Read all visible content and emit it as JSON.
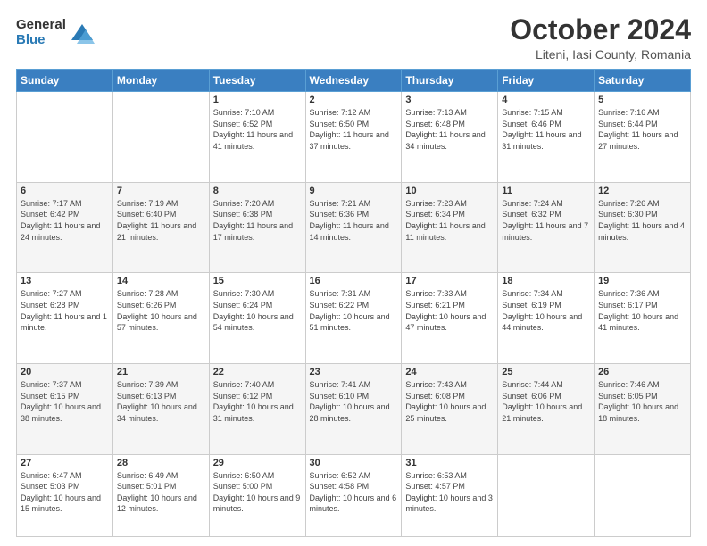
{
  "header": {
    "logo_general": "General",
    "logo_blue": "Blue",
    "month": "October 2024",
    "location": "Liteni, Iasi County, Romania"
  },
  "days_of_week": [
    "Sunday",
    "Monday",
    "Tuesday",
    "Wednesday",
    "Thursday",
    "Friday",
    "Saturday"
  ],
  "weeks": [
    [
      {
        "day": "",
        "detail": ""
      },
      {
        "day": "",
        "detail": ""
      },
      {
        "day": "1",
        "detail": "Sunrise: 7:10 AM\nSunset: 6:52 PM\nDaylight: 11 hours and 41 minutes."
      },
      {
        "day": "2",
        "detail": "Sunrise: 7:12 AM\nSunset: 6:50 PM\nDaylight: 11 hours and 37 minutes."
      },
      {
        "day": "3",
        "detail": "Sunrise: 7:13 AM\nSunset: 6:48 PM\nDaylight: 11 hours and 34 minutes."
      },
      {
        "day": "4",
        "detail": "Sunrise: 7:15 AM\nSunset: 6:46 PM\nDaylight: 11 hours and 31 minutes."
      },
      {
        "day": "5",
        "detail": "Sunrise: 7:16 AM\nSunset: 6:44 PM\nDaylight: 11 hours and 27 minutes."
      }
    ],
    [
      {
        "day": "6",
        "detail": "Sunrise: 7:17 AM\nSunset: 6:42 PM\nDaylight: 11 hours and 24 minutes."
      },
      {
        "day": "7",
        "detail": "Sunrise: 7:19 AM\nSunset: 6:40 PM\nDaylight: 11 hours and 21 minutes."
      },
      {
        "day": "8",
        "detail": "Sunrise: 7:20 AM\nSunset: 6:38 PM\nDaylight: 11 hours and 17 minutes."
      },
      {
        "day": "9",
        "detail": "Sunrise: 7:21 AM\nSunset: 6:36 PM\nDaylight: 11 hours and 14 minutes."
      },
      {
        "day": "10",
        "detail": "Sunrise: 7:23 AM\nSunset: 6:34 PM\nDaylight: 11 hours and 11 minutes."
      },
      {
        "day": "11",
        "detail": "Sunrise: 7:24 AM\nSunset: 6:32 PM\nDaylight: 11 hours and 7 minutes."
      },
      {
        "day": "12",
        "detail": "Sunrise: 7:26 AM\nSunset: 6:30 PM\nDaylight: 11 hours and 4 minutes."
      }
    ],
    [
      {
        "day": "13",
        "detail": "Sunrise: 7:27 AM\nSunset: 6:28 PM\nDaylight: 11 hours and 1 minute."
      },
      {
        "day": "14",
        "detail": "Sunrise: 7:28 AM\nSunset: 6:26 PM\nDaylight: 10 hours and 57 minutes."
      },
      {
        "day": "15",
        "detail": "Sunrise: 7:30 AM\nSunset: 6:24 PM\nDaylight: 10 hours and 54 minutes."
      },
      {
        "day": "16",
        "detail": "Sunrise: 7:31 AM\nSunset: 6:22 PM\nDaylight: 10 hours and 51 minutes."
      },
      {
        "day": "17",
        "detail": "Sunrise: 7:33 AM\nSunset: 6:21 PM\nDaylight: 10 hours and 47 minutes."
      },
      {
        "day": "18",
        "detail": "Sunrise: 7:34 AM\nSunset: 6:19 PM\nDaylight: 10 hours and 44 minutes."
      },
      {
        "day": "19",
        "detail": "Sunrise: 7:36 AM\nSunset: 6:17 PM\nDaylight: 10 hours and 41 minutes."
      }
    ],
    [
      {
        "day": "20",
        "detail": "Sunrise: 7:37 AM\nSunset: 6:15 PM\nDaylight: 10 hours and 38 minutes."
      },
      {
        "day": "21",
        "detail": "Sunrise: 7:39 AM\nSunset: 6:13 PM\nDaylight: 10 hours and 34 minutes."
      },
      {
        "day": "22",
        "detail": "Sunrise: 7:40 AM\nSunset: 6:12 PM\nDaylight: 10 hours and 31 minutes."
      },
      {
        "day": "23",
        "detail": "Sunrise: 7:41 AM\nSunset: 6:10 PM\nDaylight: 10 hours and 28 minutes."
      },
      {
        "day": "24",
        "detail": "Sunrise: 7:43 AM\nSunset: 6:08 PM\nDaylight: 10 hours and 25 minutes."
      },
      {
        "day": "25",
        "detail": "Sunrise: 7:44 AM\nSunset: 6:06 PM\nDaylight: 10 hours and 21 minutes."
      },
      {
        "day": "26",
        "detail": "Sunrise: 7:46 AM\nSunset: 6:05 PM\nDaylight: 10 hours and 18 minutes."
      }
    ],
    [
      {
        "day": "27",
        "detail": "Sunrise: 6:47 AM\nSunset: 5:03 PM\nDaylight: 10 hours and 15 minutes."
      },
      {
        "day": "28",
        "detail": "Sunrise: 6:49 AM\nSunset: 5:01 PM\nDaylight: 10 hours and 12 minutes."
      },
      {
        "day": "29",
        "detail": "Sunrise: 6:50 AM\nSunset: 5:00 PM\nDaylight: 10 hours and 9 minutes."
      },
      {
        "day": "30",
        "detail": "Sunrise: 6:52 AM\nSunset: 4:58 PM\nDaylight: 10 hours and 6 minutes."
      },
      {
        "day": "31",
        "detail": "Sunrise: 6:53 AM\nSunset: 4:57 PM\nDaylight: 10 hours and 3 minutes."
      },
      {
        "day": "",
        "detail": ""
      },
      {
        "day": "",
        "detail": ""
      }
    ]
  ]
}
